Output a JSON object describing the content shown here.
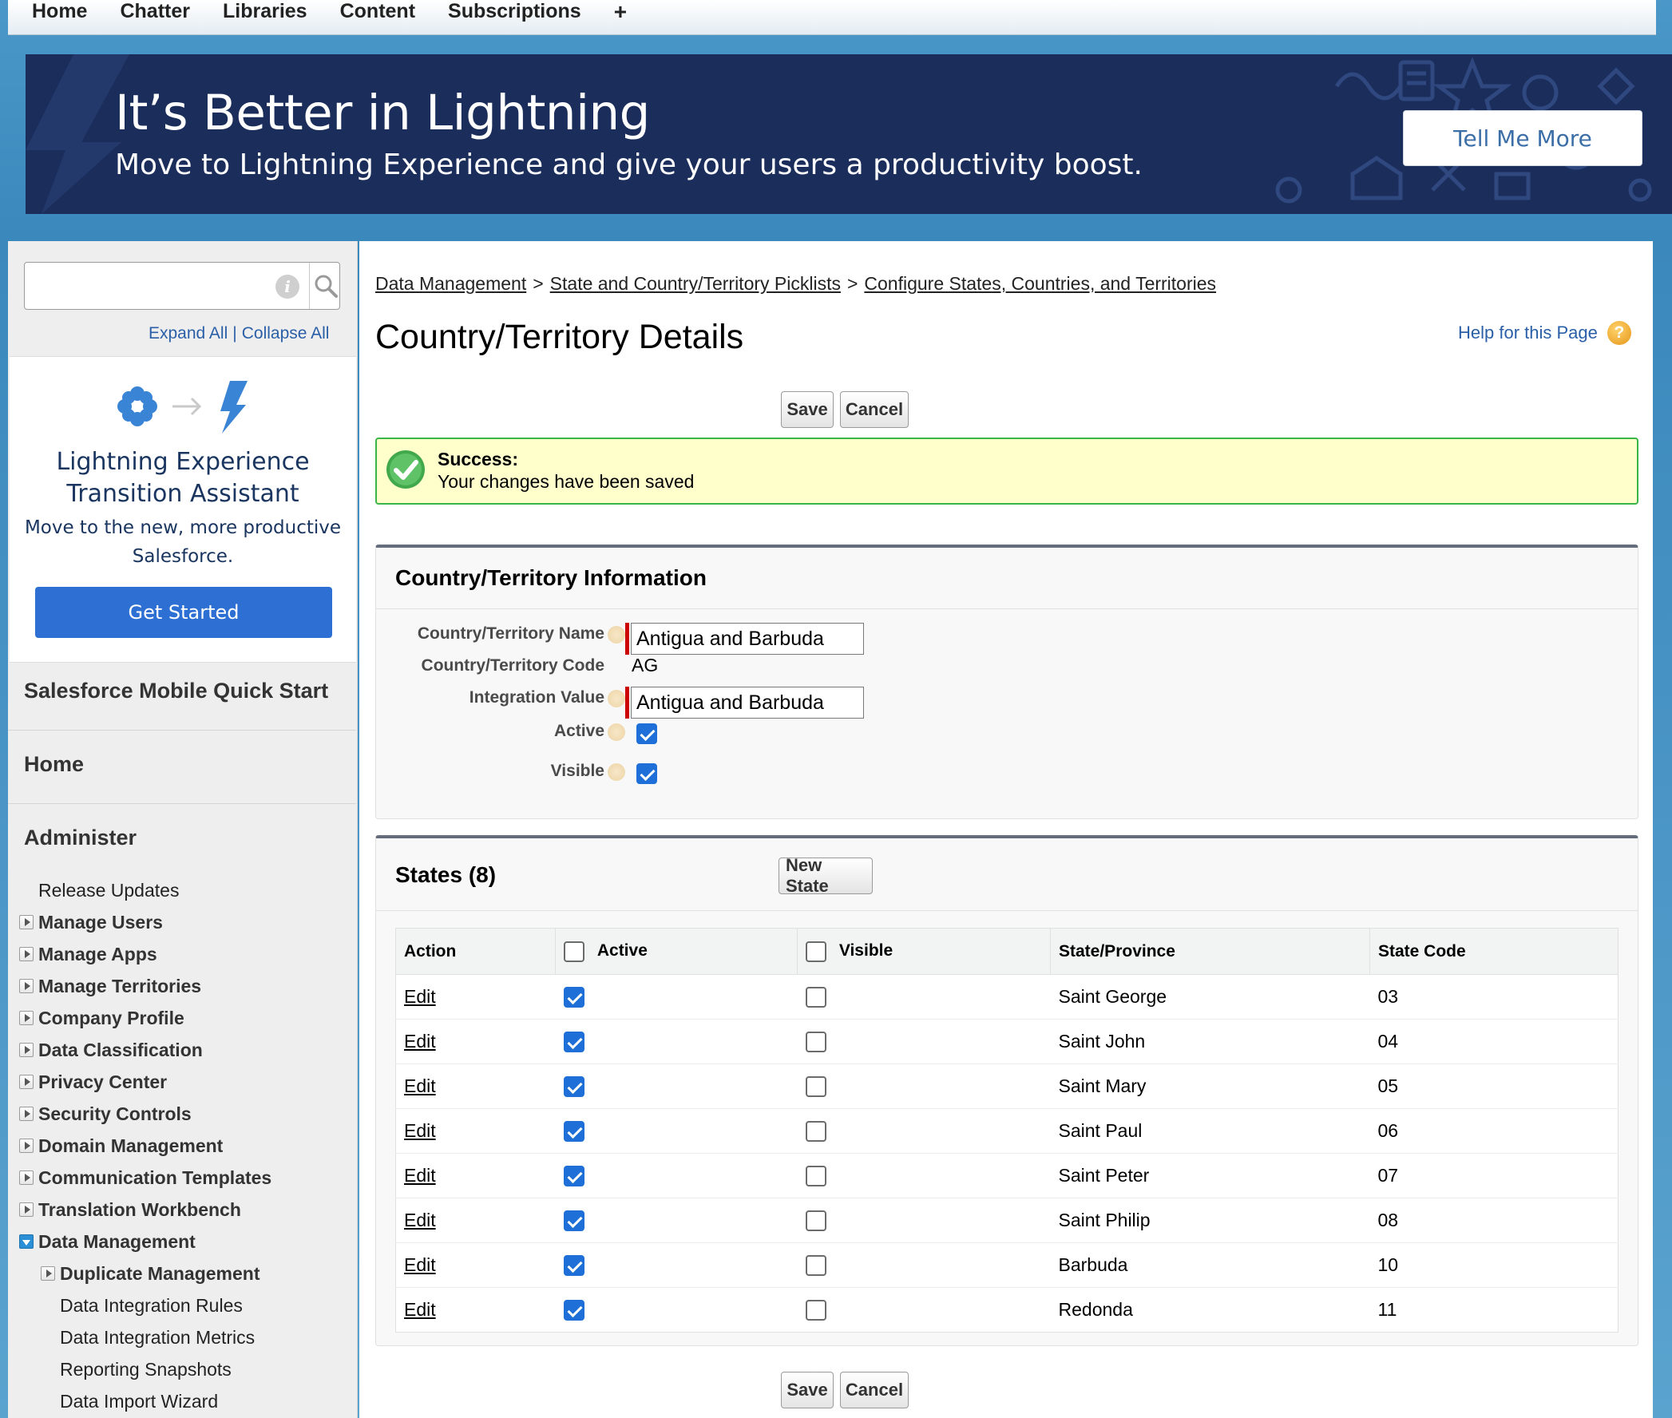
{
  "topnav": {
    "tabs": [
      "Home",
      "Chatter",
      "Libraries",
      "Content",
      "Subscriptions"
    ],
    "add": "+"
  },
  "banner": {
    "title": "It’s Better in Lightning",
    "subtitle": "Move to Lightning Experience and give your users a productivity boost.",
    "button": "Tell Me More"
  },
  "sidebar": {
    "search_value": "",
    "expand_all": "Expand All",
    "separator": "|",
    "collapse_all": "Collapse All",
    "lex": {
      "title": "Lightning Experience Transition Assistant",
      "text": "Move to the new, more productive Salesforce.",
      "button": "Get Started"
    },
    "mobile_quick_start": "Salesforce Mobile Quick Start",
    "home": "Home",
    "administer": "Administer",
    "items": [
      {
        "label": "Release Updates",
        "toggle": "none",
        "bold": false
      },
      {
        "label": "Manage Users",
        "toggle": "closed",
        "bold": true
      },
      {
        "label": "Manage Apps",
        "toggle": "closed",
        "bold": true
      },
      {
        "label": "Manage Territories",
        "toggle": "closed",
        "bold": true
      },
      {
        "label": "Company Profile",
        "toggle": "closed",
        "bold": true
      },
      {
        "label": "Data Classification",
        "toggle": "closed",
        "bold": true
      },
      {
        "label": "Privacy Center",
        "toggle": "closed",
        "bold": true
      },
      {
        "label": "Security Controls",
        "toggle": "closed",
        "bold": true
      },
      {
        "label": "Domain Management",
        "toggle": "closed",
        "bold": true
      },
      {
        "label": "Communication Templates",
        "toggle": "closed",
        "bold": true
      },
      {
        "label": "Translation Workbench",
        "toggle": "closed",
        "bold": true
      },
      {
        "label": "Data Management",
        "toggle": "open",
        "bold": true
      }
    ],
    "sub_items": [
      {
        "label": "Duplicate Management",
        "toggle": "closed",
        "bold": true
      },
      {
        "label": "Data Integration Rules",
        "toggle": "none",
        "bold": false
      },
      {
        "label": "Data Integration Metrics",
        "toggle": "none",
        "bold": false
      },
      {
        "label": "Reporting Snapshots",
        "toggle": "none",
        "bold": false
      },
      {
        "label": "Data Import Wizard",
        "toggle": "none",
        "bold": false
      }
    ]
  },
  "breadcrumb": {
    "items": [
      "Data Management",
      "State and Country/Territory Picklists",
      "Configure States, Countries, and Territories"
    ],
    "separator": ">"
  },
  "page": {
    "title": "Country/Territory Details",
    "help": "Help for this Page",
    "help_icon": "?",
    "save": "Save",
    "cancel": "Cancel"
  },
  "success": {
    "heading": "Success:",
    "message": "Your changes have been saved"
  },
  "info": {
    "title": "Country/Territory Information",
    "name_label": "Country/Territory Name",
    "name_value": "Antigua and Barbuda",
    "code_label": "Country/Territory Code",
    "code_value": "AG",
    "integration_label": "Integration Value",
    "integration_value": "Antigua and Barbuda",
    "active_label": "Active",
    "active": true,
    "visible_label": "Visible",
    "visible": true
  },
  "states": {
    "title": "States (8)",
    "new_button": "New State",
    "columns": [
      "Action",
      "Active",
      "Visible",
      "State/Province",
      "State Code"
    ],
    "rows": [
      {
        "action": "Edit",
        "active": true,
        "visible": false,
        "name": "Saint George",
        "code": "03"
      },
      {
        "action": "Edit",
        "active": true,
        "visible": false,
        "name": "Saint John",
        "code": "04"
      },
      {
        "action": "Edit",
        "active": true,
        "visible": false,
        "name": "Saint Mary",
        "code": "05"
      },
      {
        "action": "Edit",
        "active": true,
        "visible": false,
        "name": "Saint Paul",
        "code": "06"
      },
      {
        "action": "Edit",
        "active": true,
        "visible": false,
        "name": "Saint Peter",
        "code": "07"
      },
      {
        "action": "Edit",
        "active": true,
        "visible": false,
        "name": "Saint Philip",
        "code": "08"
      },
      {
        "action": "Edit",
        "active": true,
        "visible": false,
        "name": "Barbuda",
        "code": "10"
      },
      {
        "action": "Edit",
        "active": true,
        "visible": false,
        "name": "Redonda",
        "code": "11"
      }
    ]
  }
}
